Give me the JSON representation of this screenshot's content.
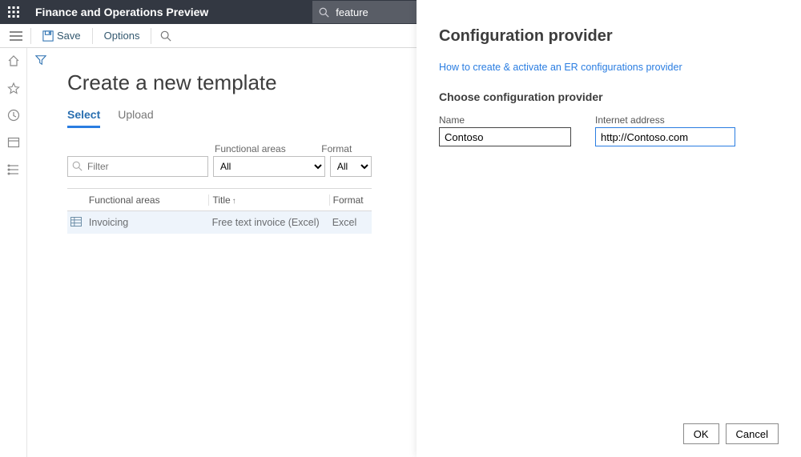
{
  "topbar": {
    "app_title": "Finance and Operations Preview",
    "search_value": "feature"
  },
  "actionbar": {
    "save_label": "Save",
    "options_label": "Options"
  },
  "page": {
    "title": "Create a new template",
    "tabs": {
      "select": "Select",
      "upload": "Upload"
    },
    "filters": {
      "filter_placeholder": "Filter",
      "func_areas_label": "Functional areas",
      "func_areas_value": "All",
      "format_label": "Format",
      "format_value": "All"
    },
    "grid": {
      "col_func_areas": "Functional areas",
      "col_title": "Title",
      "col_format": "Format",
      "rows": [
        {
          "func_areas": "Invoicing",
          "title": "Free text invoice (Excel)",
          "format": "Excel"
        }
      ]
    }
  },
  "panel": {
    "title": "Configuration provider",
    "link": "How to create & activate an ER configurations provider",
    "subtitle": "Choose configuration provider",
    "name_label": "Name",
    "name_value": "Contoso",
    "addr_label": "Internet address",
    "addr_value": "http://Contoso.com",
    "ok": "OK",
    "cancel": "Cancel"
  }
}
